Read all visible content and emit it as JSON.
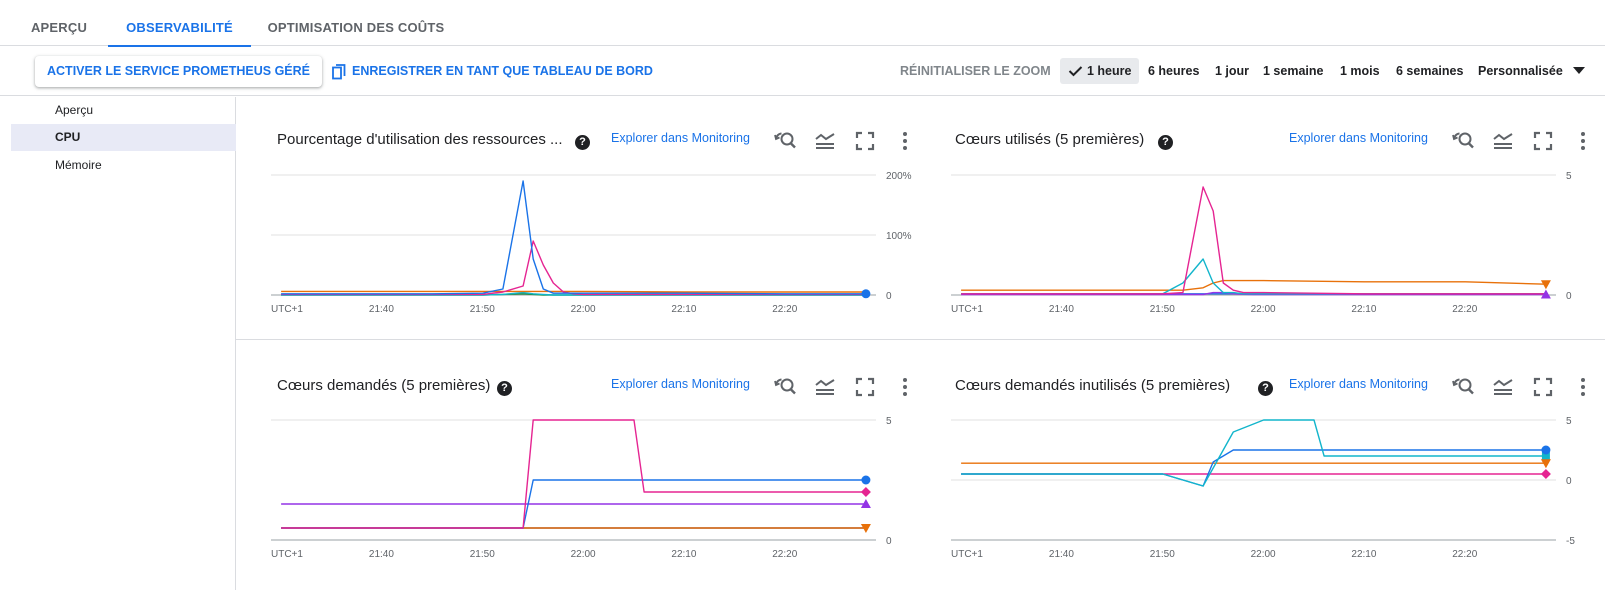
{
  "tabs": [
    {
      "label": "APERÇU",
      "active": false
    },
    {
      "label": "OBSERVABILITÉ",
      "active": true
    },
    {
      "label": "OPTIMISATION DES COÛTS",
      "active": false
    }
  ],
  "toolbar": {
    "activate_label": "ACTIVER LE SERVICE PROMETHEUS GÉRÉ",
    "save_label": "ENREGISTRER EN TANT QUE TABLEAU DE BORD",
    "reset_zoom_label": "RÉINITIALISER LE ZOOM",
    "ranges": [
      "1 heure",
      "6 heures",
      "1 jour",
      "1 semaine",
      "1 mois",
      "6 semaines",
      "Personnalisée"
    ],
    "selected_range": "1 heure"
  },
  "sidenav": {
    "items": [
      {
        "label": "Aperçu",
        "active": false
      },
      {
        "label": "CPU",
        "active": true
      },
      {
        "label": "Mémoire",
        "active": false
      }
    ]
  },
  "colors": {
    "blue": "#1a73e8",
    "pink": "#e52592",
    "orange": "#e8710a",
    "purple": "#9334e6",
    "teal": "#12b5cb",
    "green": "#1e8e3e",
    "navy": "#3949ab"
  },
  "x_ticks": [
    "UTC+1",
    "21:40",
    "21:50",
    "22:00",
    "22:10",
    "22:20"
  ],
  "charts": [
    {
      "title": "Pourcentage d'utilisation des ressources ...",
      "help": "?",
      "explore_label": "Explorer dans Monitoring",
      "icons": [
        "zoom-reset-icon",
        "legend-icon",
        "fullscreen-icon",
        "more-icon"
      ],
      "chart_data": {
        "type": "line",
        "x": [
          "21:30",
          "21:35",
          "21:40",
          "21:45",
          "21:50",
          "21:52",
          "21:54",
          "21:55",
          "21:56",
          "21:57",
          "21:58",
          "21:59",
          "22:00",
          "22:10",
          "22:20",
          "22:28"
        ],
        "y_ticks": [
          "200%",
          "100%",
          "0"
        ],
        "ylim": [
          0,
          200
        ],
        "series": [
          {
            "color": "#1a73e8",
            "marker": "circle",
            "values": [
              2,
              2,
              2,
              2,
              3,
              10,
              190,
              60,
              10,
              3,
              3,
              3,
              3,
              3,
              2,
              2
            ]
          },
          {
            "color": "#e52592",
            "marker": "none",
            "values": [
              1,
              1,
              1,
              1,
              1,
              5,
              15,
              90,
              50,
              20,
              5,
              2,
              1,
              1,
              1,
              1
            ]
          },
          {
            "color": "#e8710a",
            "marker": "none",
            "values": [
              6,
              6,
              6,
              6,
              6,
              6,
              6,
              6,
              6,
              6,
              6,
              6,
              6,
              5,
              5,
              5
            ]
          },
          {
            "color": "#12b5cb",
            "marker": "none",
            "values": [
              0,
              0,
              0,
              0,
              0,
              1,
              4,
              2,
              1,
              0,
              0,
              0,
              0,
              0,
              0,
              0
            ]
          },
          {
            "color": "#1e8e3e",
            "marker": "none",
            "values": [
              0,
              0,
              0,
              0,
              0,
              1,
              2,
              1,
              0,
              0,
              0,
              0,
              0,
              0,
              0,
              0
            ]
          }
        ]
      }
    },
    {
      "title": "Cœurs utilisés (5 premières)",
      "help": "?",
      "explore_label": "Explorer dans Monitoring",
      "icons": [
        "zoom-reset-icon",
        "legend-icon",
        "fullscreen-icon",
        "more-icon"
      ],
      "chart_data": {
        "type": "line",
        "x": [
          "21:30",
          "21:35",
          "21:40",
          "21:45",
          "21:50",
          "21:52",
          "21:54",
          "21:55",
          "21:56",
          "21:57",
          "21:58",
          "21:59",
          "22:00",
          "22:10",
          "22:20",
          "22:28"
        ],
        "y_ticks": [
          "5",
          "0"
        ],
        "ylim": [
          0,
          5
        ],
        "series": [
          {
            "color": "#e52592",
            "marker": "none",
            "values": [
              0.05,
              0.05,
              0.05,
              0.05,
              0.05,
              0.1,
              4.5,
              3.5,
              0.5,
              0.2,
              0.1,
              0.1,
              0.1,
              0.05,
              0.05,
              0.05
            ]
          },
          {
            "color": "#12b5cb",
            "marker": "none",
            "values": [
              0.05,
              0.05,
              0.05,
              0.05,
              0.05,
              0.5,
              1.5,
              0.5,
              0.1,
              0.1,
              0.05,
              0.05,
              0.05,
              0.05,
              0.05,
              0.05
            ]
          },
          {
            "color": "#e8710a",
            "marker": "triangle-down",
            "values": [
              0.2,
              0.2,
              0.2,
              0.2,
              0.2,
              0.2,
              0.3,
              0.5,
              0.6,
              0.6,
              0.6,
              0.6,
              0.6,
              0.55,
              0.55,
              0.45
            ]
          },
          {
            "color": "#9334e6",
            "marker": "triangle-up",
            "values": [
              0.02,
              0.02,
              0.02,
              0.02,
              0.02,
              0.02,
              0.02,
              0.1,
              0.1,
              0.05,
              0.03,
              0.02,
              0.02,
              0.02,
              0.02,
              0.02
            ]
          },
          {
            "color": "#1a73e8",
            "marker": "none",
            "values": [
              0.05,
              0.05,
              0.05,
              0.05,
              0.05,
              0.05,
              0.05,
              0.05,
              0.05,
              0.05,
              0.05,
              0.05,
              0.05,
              0.05,
              0.05,
              0.05
            ]
          }
        ]
      }
    },
    {
      "title": "Cœurs demandés (5 premières)",
      "help": "?",
      "explore_label": "Explorer dans Monitoring",
      "icons": [
        "zoom-reset-icon",
        "legend-icon",
        "fullscreen-icon",
        "more-icon"
      ],
      "chart_data": {
        "type": "line",
        "x": [
          "21:30",
          "21:40",
          "21:50",
          "21:54",
          "21:55",
          "22:00",
          "22:05",
          "22:06",
          "22:10",
          "22:20",
          "22:28"
        ],
        "y_ticks": [
          "5",
          "0"
        ],
        "ylim": [
          0,
          5
        ],
        "series": [
          {
            "color": "#e52592",
            "marker": "diamond",
            "values": [
              0.5,
              0.5,
              0.5,
              0.5,
              5,
              5,
              5,
              2,
              2,
              2,
              2
            ]
          },
          {
            "color": "#1a73e8",
            "marker": "circle",
            "values": [
              0.5,
              0.5,
              0.5,
              0.5,
              2.5,
              2.5,
              2.5,
              2.5,
              2.5,
              2.5,
              2.5
            ]
          },
          {
            "color": "#9334e6",
            "marker": "triangle-up",
            "values": [
              1.5,
              1.5,
              1.5,
              1.5,
              1.5,
              1.5,
              1.5,
              1.5,
              1.5,
              1.5,
              1.5
            ]
          },
          {
            "color": "#e8710a",
            "marker": "triangle-down",
            "values": [
              0.5,
              0.5,
              0.5,
              0.5,
              0.5,
              0.5,
              0.5,
              0.5,
              0.5,
              0.5,
              0.5
            ]
          },
          {
            "color": "#3949ab",
            "marker": "none",
            "values": [
              0.5,
              0.5,
              0.5,
              0.5,
              0.5,
              0.5,
              0.5,
              0.5,
              0.5,
              0.5,
              0.5
            ]
          }
        ]
      }
    },
    {
      "title": "Cœurs demandés inutilisés (5 premières)",
      "help": "?",
      "explore_label": "Explorer dans Monitoring",
      "icons": [
        "zoom-reset-icon",
        "legend-icon",
        "fullscreen-icon",
        "more-icon"
      ],
      "chart_data": {
        "type": "line",
        "x": [
          "21:30",
          "21:40",
          "21:50",
          "21:54",
          "21:55",
          "21:57",
          "22:00",
          "22:05",
          "22:06",
          "22:10",
          "22:20",
          "22:28"
        ],
        "y_ticks": [
          "5",
          "0",
          "-5"
        ],
        "ylim": [
          -5,
          5
        ],
        "series": [
          {
            "color": "#12b5cb",
            "marker": "square",
            "values": [
              0.5,
              0.5,
              0.5,
              -0.5,
              1,
              4,
              5,
              5,
              2,
              2,
              2,
              2
            ]
          },
          {
            "color": "#1a73e8",
            "marker": "circle",
            "values": [
              0.5,
              0.5,
              0.5,
              -0.5,
              1.5,
              2.5,
              2.5,
              2.5,
              2.5,
              2.5,
              2.5,
              2.5
            ]
          },
          {
            "color": "#e8710a",
            "marker": "triangle-down",
            "values": [
              1.4,
              1.4,
              1.4,
              1.4,
              1.4,
              1.4,
              1.4,
              1.4,
              1.4,
              1.4,
              1.4,
              1.4
            ]
          },
          {
            "color": "#e52592",
            "marker": "diamond",
            "values": [
              0.5,
              0.5,
              0.5,
              0.5,
              0.5,
              0.5,
              0.5,
              0.5,
              0.5,
              0.5,
              0.5,
              0.5
            ]
          }
        ]
      }
    }
  ]
}
